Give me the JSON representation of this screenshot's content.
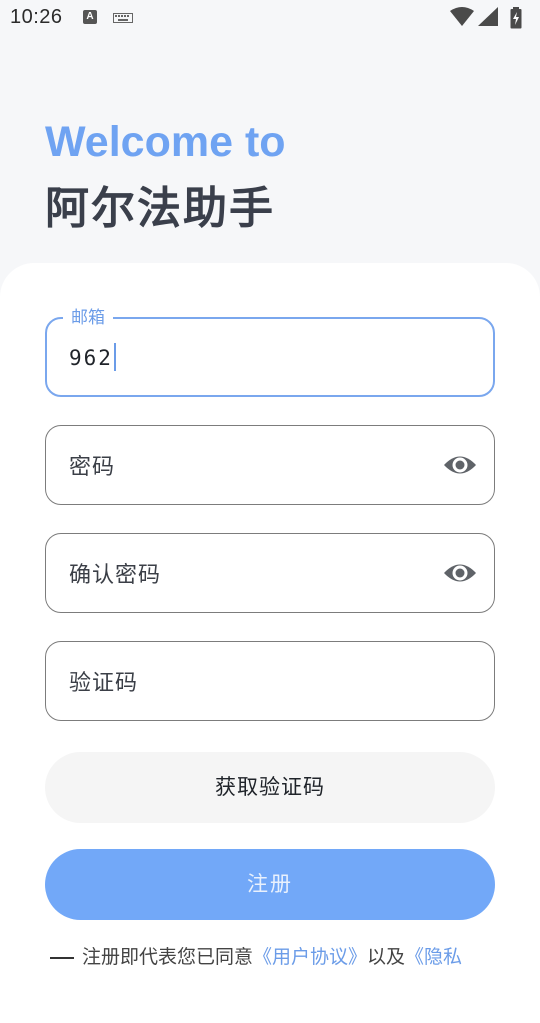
{
  "status_bar": {
    "time": "10:26",
    "notif_letter": "A",
    "icons": [
      "text-a-icon",
      "keyboard-icon",
      "wifi-icon",
      "cellular-signal-icon",
      "battery-icon"
    ]
  },
  "header": {
    "welcome": "Welcome to",
    "app_name": "阿尔法助手"
  },
  "form": {
    "email": {
      "label": "邮箱",
      "value": "962"
    },
    "password": {
      "placeholder": "密码"
    },
    "confirm_password": {
      "placeholder": "确认密码"
    },
    "code": {
      "placeholder": "验证码"
    },
    "get_code_button": "获取验证码",
    "register_button": "注册"
  },
  "agreement": {
    "prefix": "注册即代表您已同意",
    "user_agreement": "《用户协议》",
    "and": "以及",
    "privacy": "《隐私"
  },
  "colors": {
    "accent": "#6fa3f2",
    "primary_button": "#72a8f8",
    "focus_border": "#7aa7ee"
  }
}
